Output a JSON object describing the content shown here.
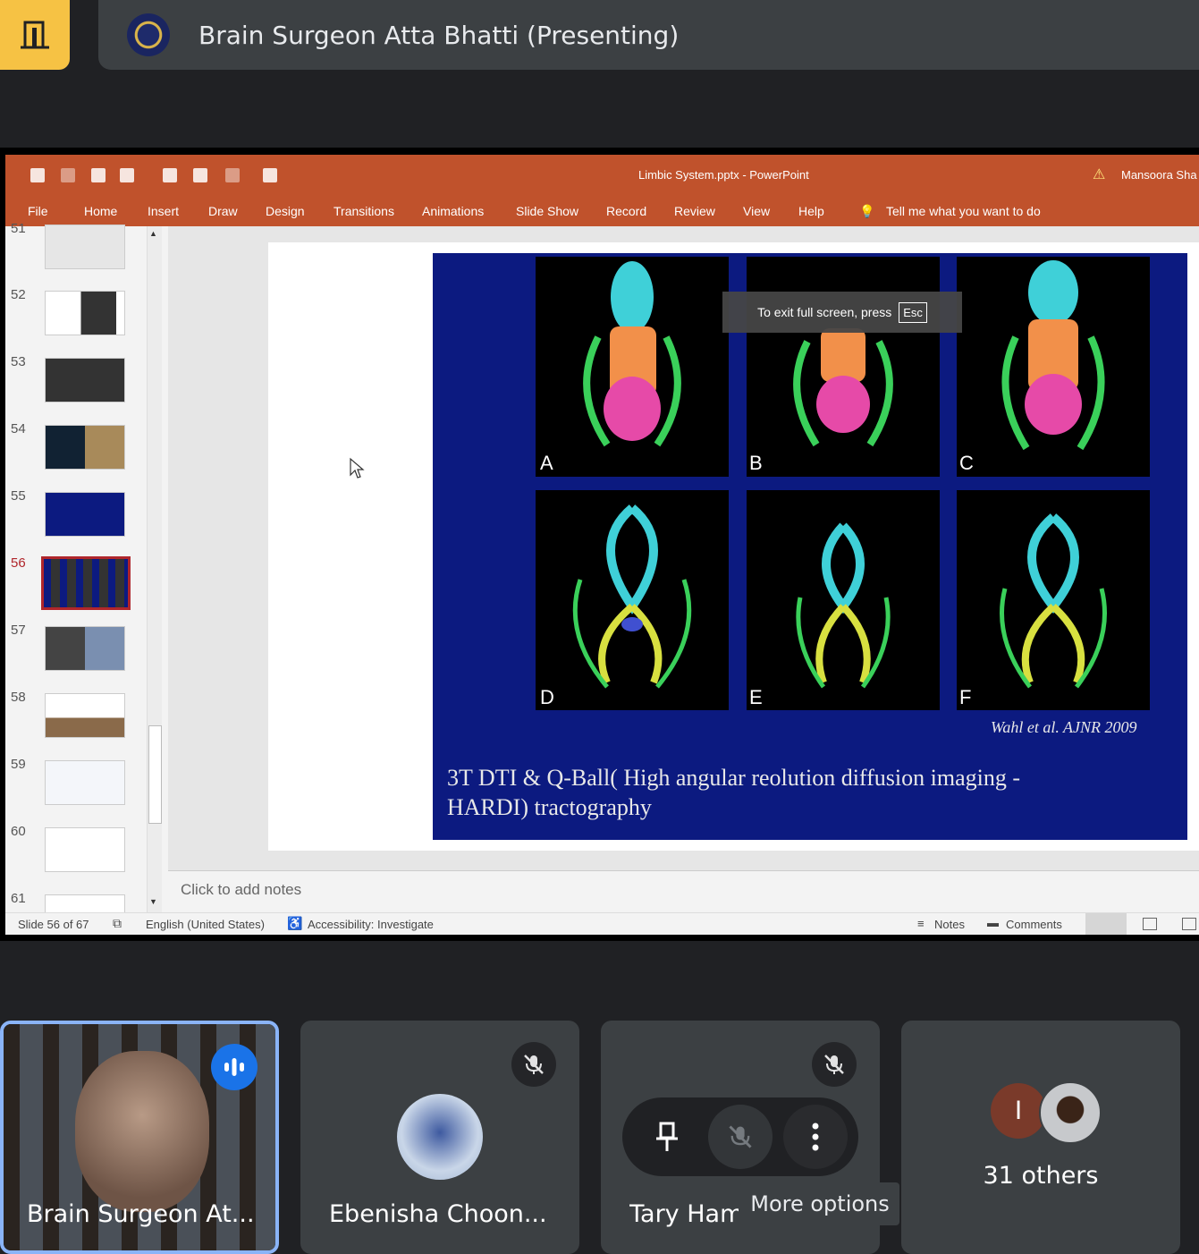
{
  "presenter_bar": {
    "title": "Brain Surgeon Atta Bhatti (Presenting)"
  },
  "powerpoint": {
    "window_title": "Limbic System.pptx  -  PowerPoint",
    "user": "Mansoora Sha",
    "ribbon_tabs": [
      "File",
      "Home",
      "Insert",
      "Draw",
      "Design",
      "Transitions",
      "Animations",
      "Slide Show",
      "Record",
      "Review",
      "View",
      "Help"
    ],
    "tell_me": "Tell me what you want to do",
    "slide_numbers": [
      "51",
      "52",
      "53",
      "54",
      "55",
      "56",
      "57",
      "58",
      "59",
      "60",
      "61"
    ],
    "selected_slide": "56",
    "fullscreen_tip": "To exit full screen, press",
    "esc_key": "Esc",
    "slide": {
      "panel_labels": [
        "A",
        "B",
        "C",
        "D",
        "E",
        "F"
      ],
      "citation": "Wahl et al. AJNR 2009",
      "caption_line1": "3T DTI & Q-Ball( High angular reolution diffusion imaging -",
      "caption_line2": "HARDI)  tractography"
    },
    "notes_placeholder": "Click to add notes",
    "status": {
      "slide_counter": "Slide 56 of 67",
      "language": "English (United States)",
      "accessibility": "Accessibility: Investigate",
      "notes": "Notes",
      "comments": "Comments"
    },
    "colors": {
      "ribbon": "#c0522c",
      "slide_bg": "#0c1a80",
      "selected_thumb": "#b0262b"
    }
  },
  "participants": [
    {
      "name": "Brain Surgeon At...",
      "speaking": true
    },
    {
      "name": "Ebenisha Choon...",
      "muted": true
    },
    {
      "name": "Tary Ham",
      "muted": true
    },
    {
      "name": "31 others",
      "avatar_initial": "I"
    }
  ],
  "tooltip": {
    "text": "More options"
  },
  "colors": {
    "exit_button": "#f6c244",
    "active_speaker": "#8ab4f8",
    "speaking_badge": "#1a73e8",
    "tile_bg": "#3c4043"
  }
}
